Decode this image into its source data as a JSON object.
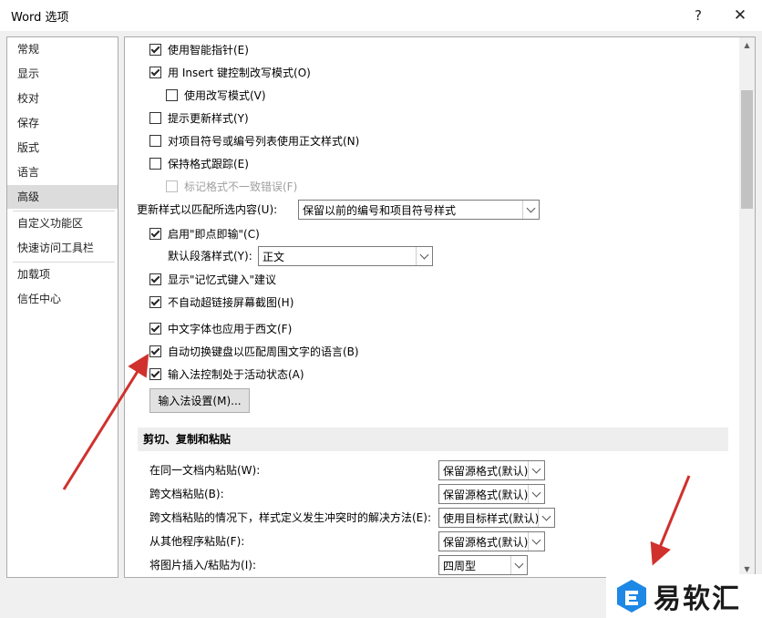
{
  "window": {
    "title": "Word 选项",
    "help": "?",
    "close": "✕"
  },
  "sidebar": {
    "items": [
      {
        "label": "常规"
      },
      {
        "label": "显示"
      },
      {
        "label": "校对"
      },
      {
        "label": "保存"
      },
      {
        "label": "版式"
      },
      {
        "label": "语言"
      },
      {
        "label": "高级",
        "active": true
      },
      {
        "label": "自定义功能区"
      },
      {
        "label": "快速访问工具栏"
      },
      {
        "label": "加载项"
      },
      {
        "label": "信任中心"
      }
    ]
  },
  "options": {
    "smart_pointer": "使用智能指针(E)",
    "insert_key": "用 Insert 键控制改写模式(O)",
    "overtype": "使用改写模式(V)",
    "prompt_update_style": "提示更新样式(Y)",
    "normal_style_bullets": "对项目符号或编号列表使用正文样式(N)",
    "keep_format_tracking": "保持格式跟踪(E)",
    "mark_inconsistencies": "标记格式不一致错误(F)",
    "update_style_label": "更新样式以匹配所选内容(U):",
    "update_style_value": "保留以前的编号和项目符号样式",
    "click_and_type": "启用\"即点即输\"(C)",
    "default_para_label": "默认段落样式(Y):",
    "default_para_value": "正文",
    "autocomplete": "显示\"记忆式键入\"建议",
    "no_auto_hyperlink": "不自动超链接屏幕截图(H)",
    "cn_font_western": "中文字体也应用于西文(F)",
    "auto_keyboard": "自动切换键盘以匹配周围文字的语言(B)",
    "ime_control": "输入法控制处于活动状态(A)",
    "ime_settings_button": "输入法设置(M)..."
  },
  "cut_copy_paste": {
    "header": "剪切、复制和粘贴",
    "rows": [
      {
        "label": "在同一文档内粘贴(W):",
        "value": "保留源格式(默认)"
      },
      {
        "label": "跨文档粘贴(B):",
        "value": "保留源格式(默认)"
      },
      {
        "label": "跨文档粘贴的情况下，样式定义发生冲突时的解决方法(E):",
        "value": "使用目标样式(默认)"
      },
      {
        "label": "从其他程序粘贴(F):",
        "value": "保留源格式(默认)"
      },
      {
        "label": "将图片插入/粘贴为(I):",
        "value": "四周型"
      }
    ]
  },
  "watermark": {
    "text": "易软汇"
  },
  "colors": {
    "annotation_arrow": "#d0312d",
    "logo_blue": "#1e88e5"
  }
}
